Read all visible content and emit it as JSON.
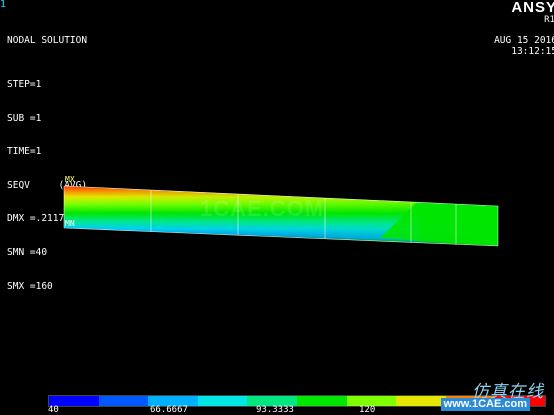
{
  "window": {
    "number": "1"
  },
  "solution": {
    "title": "NODAL SOLUTION",
    "step": "STEP=1",
    "sub": "SUB =1",
    "time": "TIME=1",
    "item": "SEQV     (AVG)",
    "dmx": "DMX =.211766",
    "smn": "SMN =40",
    "smx": "SMX =160"
  },
  "brand": {
    "logo": "ANSY",
    "release": "R1",
    "date": "AUG 15 2016",
    "time": "13:12:15"
  },
  "markers": {
    "mx": "MX",
    "mn": "MN"
  },
  "legend": {
    "colors": [
      "#0000ff",
      "#0058ff",
      "#00b0ff",
      "#00e6e6",
      "#00e680",
      "#00e600",
      "#80ff00",
      "#e6e600",
      "#ff8000",
      "#ff0000"
    ],
    "ticks": [
      "40",
      "66.6667",
      "93.3333",
      "120"
    ]
  },
  "watermark": {
    "center": "1CAE.COM",
    "cn": "仿真在线",
    "url": "www.1CAE.com"
  }
}
